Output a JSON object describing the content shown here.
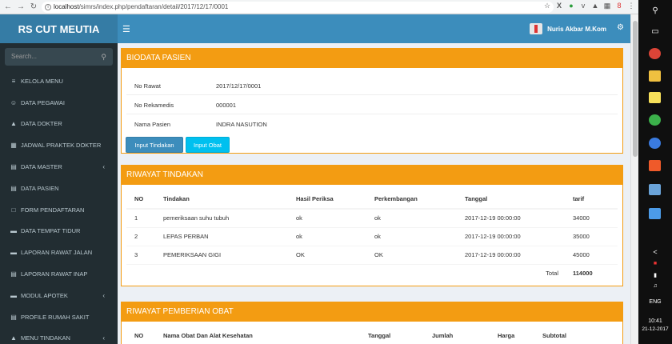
{
  "browser": {
    "url_host": "localhost",
    "url_path": "/simrs/index.php/pendaftaran/detail/2017/12/17/0001"
  },
  "app": {
    "brand": "RS CUT MEUTIA",
    "user_name": "Nuris Akbar M.Kom"
  },
  "sidebar": {
    "search_placeholder": "Search...",
    "items": [
      {
        "label": "KELOLA MENU",
        "icon": "list-icon"
      },
      {
        "label": "DATA PEGAWAI",
        "icon": "users-icon"
      },
      {
        "label": "DATA DOKTER",
        "icon": "graduation-cap-icon"
      },
      {
        "label": "JADWAL PRAKTEK DOKTER",
        "icon": "calendar-icon"
      },
      {
        "label": "DATA MASTER",
        "icon": "table-icon"
      },
      {
        "label": "DATA PASIEN",
        "icon": "table-icon"
      },
      {
        "label": "FORM PENDAFTARAN",
        "icon": "square-icon"
      },
      {
        "label": "DATA TEMPAT TIDUR",
        "icon": "bed-icon"
      },
      {
        "label": "LAPORAN RAWAT JALAN",
        "icon": "bed-icon"
      },
      {
        "label": "LAPORAN RAWAT INAP",
        "icon": "table-icon"
      },
      {
        "label": "MODUL APOTEK",
        "icon": "bed-icon"
      },
      {
        "label": "PROFILE RUMAH SAKIT",
        "icon": "table-icon"
      },
      {
        "label": "MENU TINDAKAN",
        "icon": "graduation-cap-icon"
      }
    ]
  },
  "biodata": {
    "title": "BIODATA PASIEN",
    "rows": [
      {
        "label": "No Rawat",
        "value": "2017/12/17/0001"
      },
      {
        "label": "No Rekamedis",
        "value": "000001"
      },
      {
        "label": "Nama Pasien",
        "value": "INDRA NASUTION"
      }
    ],
    "btn_tindakan": "Input Tindakan",
    "btn_obat": "Input Obat"
  },
  "tindakan": {
    "title": "RIWAYAT TINDAKAN",
    "headers": [
      "NO",
      "Tindakan",
      "Hasil Periksa",
      "Perkembangan",
      "Tanggal",
      "tarif"
    ],
    "rows": [
      [
        "1",
        "pemeriksaan suhu tubuh",
        "ok",
        "ok",
        "2017-12-19 00:00:00",
        "34000"
      ],
      [
        "2",
        "LEPAS PERBAN",
        "ok",
        "ok",
        "2017-12-19 00:00:00",
        "35000"
      ],
      [
        "3",
        "PEMERIKSAAN GIGI",
        "OK",
        "OK",
        "2017-12-19 00:00:00",
        "45000"
      ]
    ],
    "total_label": "Total",
    "total_value": "114000"
  },
  "obat": {
    "title": "RIWAYAT PEMBERIAN OBAT",
    "headers": [
      "NO",
      "Nama Obat Dan Alat Kesehatan",
      "Tanggal",
      "Jumlah",
      "Harga",
      "Subtotal"
    ]
  },
  "taskbar": {
    "language": "ENG",
    "time": "10:41",
    "date": "21-12-2017"
  }
}
